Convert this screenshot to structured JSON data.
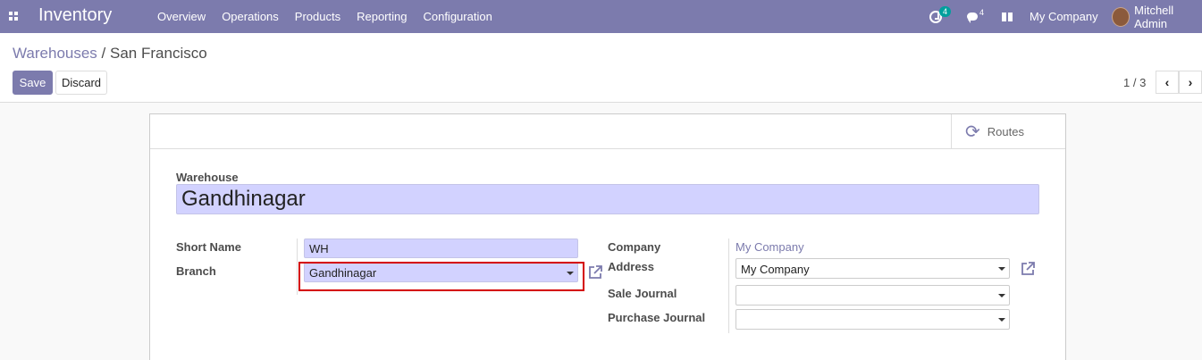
{
  "navbar": {
    "app_name": "Inventory",
    "menu": [
      "Overview",
      "Operations",
      "Products",
      "Reporting",
      "Configuration"
    ],
    "activity_count": "4",
    "message_count": "4",
    "company": "My Company",
    "user": "Mitchell Admin",
    "colors": {
      "navbar": "#7c7bad",
      "badge": "#00a09d"
    }
  },
  "control_panel": {
    "breadcrumb_parent": "Warehouses",
    "breadcrumb_sep": "/",
    "breadcrumb_current": "San Francisco",
    "save_label": "Save",
    "discard_label": "Discard",
    "pager": "1 / 3"
  },
  "sheet": {
    "routes_label": "Routes",
    "warehouse_label": "Warehouse",
    "warehouse_name": "Gandhinagar",
    "short_name_label": "Short Name",
    "short_name_value": "WH",
    "branch_label": "Branch",
    "branch_value": "Gandhinagar",
    "company_label": "Company",
    "company_value": "My Company",
    "address_label": "Address",
    "address_value": "My Company",
    "sale_journal_label": "Sale Journal",
    "sale_journal_value": "",
    "purchase_journal_label": "Purchase Journal",
    "purchase_journal_value": ""
  }
}
